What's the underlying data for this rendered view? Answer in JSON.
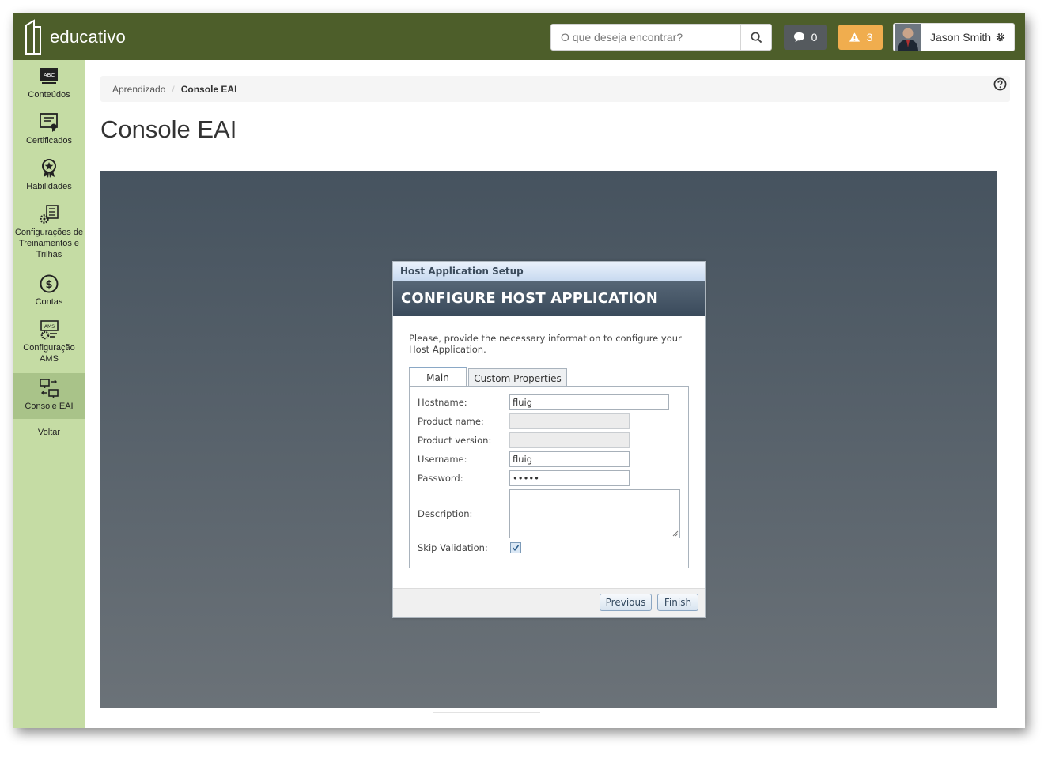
{
  "app": {
    "logo_text": "educativo"
  },
  "header": {
    "search_placeholder": "O que deseja encontrar?",
    "messages_count": "0",
    "alerts_count": "3",
    "user_name": "Jason Smith",
    "colors": {
      "topbar": "#4d5e2a",
      "alerts": "#f0ad4e",
      "messages": "#555a5e"
    }
  },
  "sidebar": {
    "items": [
      {
        "label": "Conteúdos",
        "icon": "abc-board-icon"
      },
      {
        "label": "Certificados",
        "icon": "certificate-icon"
      },
      {
        "label": "Habilidades",
        "icon": "badge-icon"
      },
      {
        "label": "Configurações de Treinamentos e Trilhas",
        "icon": "settings-list-icon"
      },
      {
        "label": "Contas",
        "icon": "dollar-icon"
      },
      {
        "label": "Configuração AMS",
        "icon": "ams-settings-icon"
      },
      {
        "label": "Console EAI",
        "icon": "network-icon",
        "active": true
      },
      {
        "label": "Voltar"
      }
    ]
  },
  "breadcrumb": {
    "parent": "Aprendizado",
    "separator": "/",
    "current": "Console EAI"
  },
  "page": {
    "title": "Console EAI"
  },
  "dialog": {
    "window_title": "Host Application Setup",
    "header": "CONFIGURE HOST APPLICATION",
    "intro": "Please, provide the necessary information to configure your Host Application.",
    "tabs": [
      "Main",
      "Custom Properties"
    ],
    "fields": {
      "hostname_label": "Hostname:",
      "hostname_value": "fluig",
      "product_name_label": "Product name:",
      "product_name_value": "",
      "product_version_label": "Product version:",
      "product_version_value": "",
      "username_label": "Username:",
      "username_value": "fluig",
      "password_label": "Password:",
      "password_value": "•••••",
      "description_label": "Description:",
      "skip_validation_label": "Skip Validation:",
      "skip_validation_checked": true
    },
    "buttons": {
      "previous": "Previous",
      "finish": "Finish"
    }
  }
}
